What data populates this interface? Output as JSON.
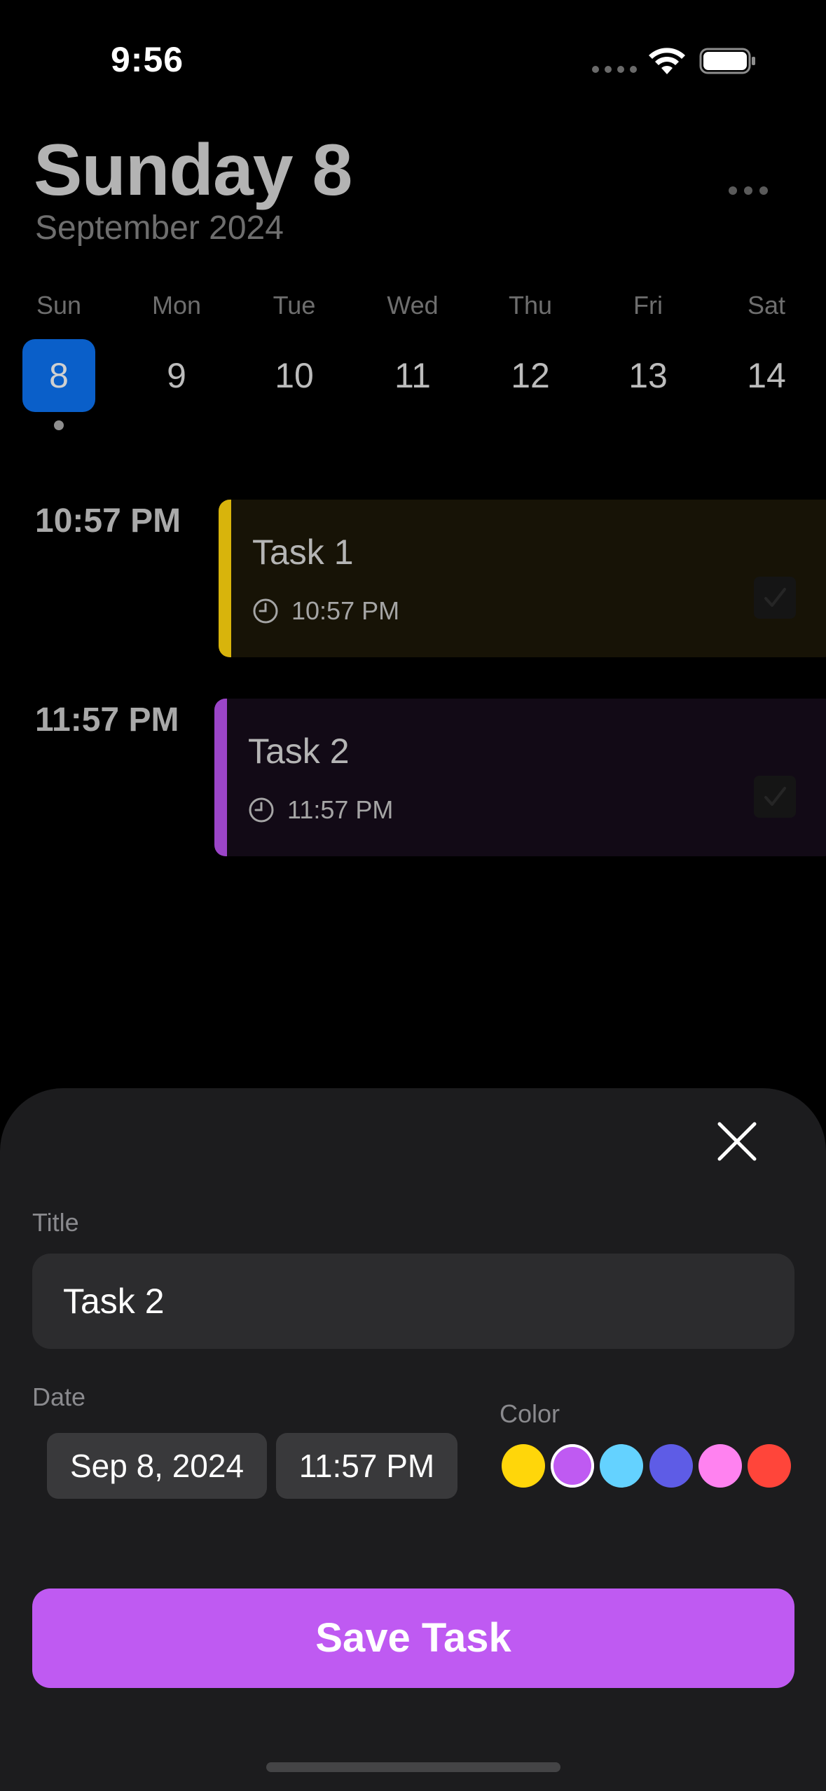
{
  "status_bar": {
    "time": "9:56"
  },
  "header": {
    "day_title": "Sunday 8",
    "month_subtitle": "September 2024"
  },
  "week": [
    {
      "name": "Sun",
      "num": "8",
      "selected": true
    },
    {
      "name": "Mon",
      "num": "9"
    },
    {
      "name": "Tue",
      "num": "10"
    },
    {
      "name": "Wed",
      "num": "11"
    },
    {
      "name": "Thu",
      "num": "12"
    },
    {
      "name": "Fri",
      "num": "13"
    },
    {
      "name": "Sat",
      "num": "14"
    }
  ],
  "tasks": [
    {
      "row_time": "10:57 PM",
      "title": "Task 1",
      "time": "10:57 PM",
      "accent": "#d8b40c",
      "card_bg": "#171306"
    },
    {
      "row_time": "11:57 PM",
      "title": "Task 2",
      "time": "11:57 PM",
      "accent": "#9b45c8",
      "card_bg": "#120a16"
    }
  ],
  "sheet": {
    "title_label": "Title",
    "title_value": "Task 2",
    "date_label": "Date",
    "date_value": "Sep 8, 2024",
    "time_value": "11:57 PM",
    "color_label": "Color",
    "colors": [
      "#ffd60a",
      "#bf5af2",
      "#64d2ff",
      "#5e5ce6",
      "#ff82f0",
      "#ff453a"
    ],
    "selected_color": "#bf5af2",
    "save_label": "Save Task"
  }
}
